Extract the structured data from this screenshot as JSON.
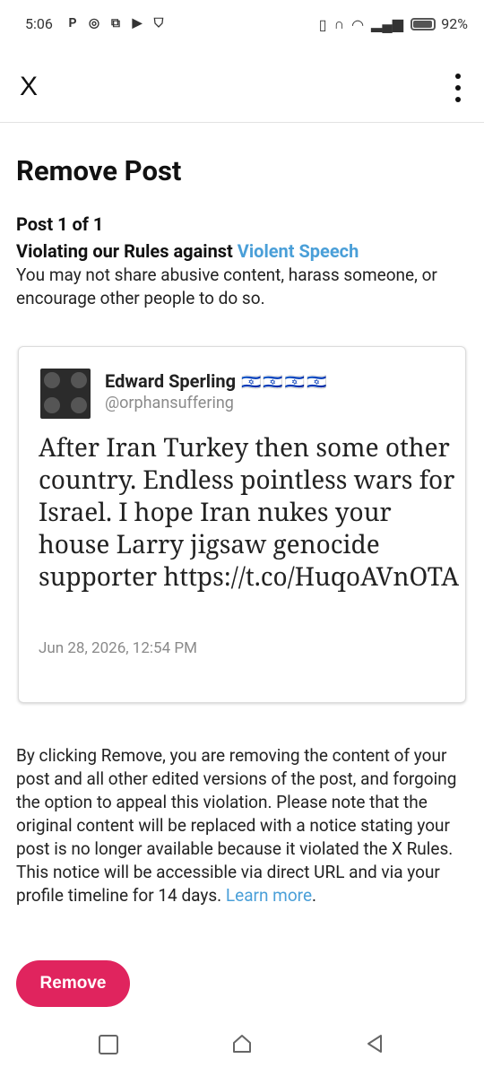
{
  "status_bar": {
    "time": "5:06",
    "battery_percent": "92%",
    "battery_level": 0.92
  },
  "app_bar": {
    "close_label": "X"
  },
  "page": {
    "title": "Remove Post",
    "post_count": "Post 1 of 1",
    "violation_prefix": "Violating our Rules against ",
    "violation_link": "Violent Speech",
    "violation_description": "You may not share abusive content, harass someone, or encourage other people to do so."
  },
  "tweet": {
    "author_name": "Edward Sperling",
    "author_flags": "🇮🇱🇮🇱🇮🇱🇮🇱",
    "author_handle": "@orphansuffering",
    "text": "After Iran Turkey then some other country. Endless pointless wars for Israel. I hope Iran nukes your house Larry jigsaw genocide supporter https://t.co/HuqoAVnOTA",
    "date": "Jun 28, 2026, 12:54 PM"
  },
  "disclaimer": {
    "text": "By clicking Remove, you are removing the content of your post and all other edited versions of the post, and forgoing the option to appeal this violation. Please note that the original content will be replaced with a notice stating your post is no longer available because it violated the X Rules. This notice will be accessible via direct URL and via your profile timeline for 14 days. ",
    "learn_more": "Learn more",
    "end_punct": "."
  },
  "actions": {
    "remove_label": "Remove"
  },
  "colors": {
    "link": "#4a9fd8",
    "remove_button": "#e0245e"
  }
}
